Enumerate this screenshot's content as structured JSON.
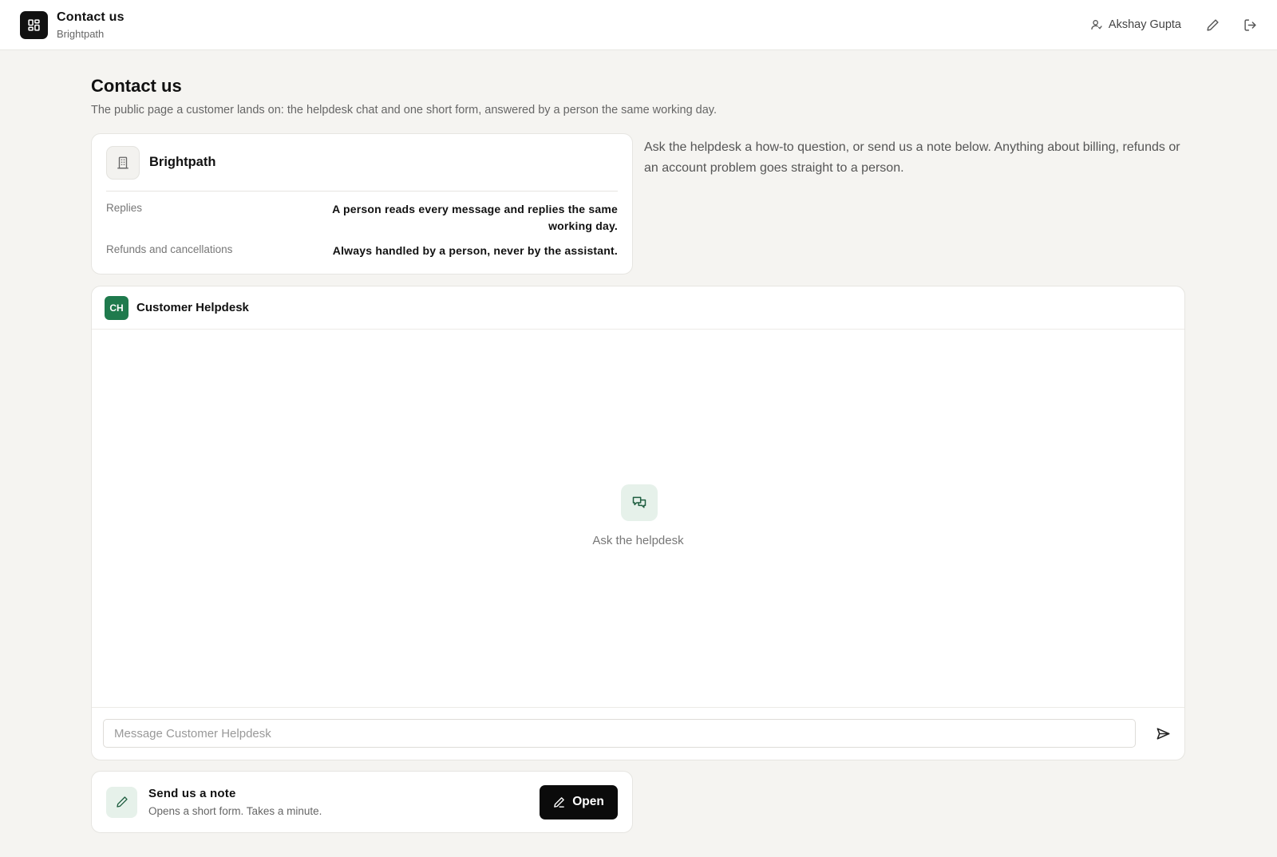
{
  "header": {
    "title": "Contact us",
    "subtitle": "Brightpath",
    "user_name": "Akshay Gupta",
    "icons": [
      "grid-icon",
      "user-icon",
      "pencil-icon",
      "logout-icon"
    ]
  },
  "page": {
    "title": "Contact us",
    "description": "The public page a customer lands on: the helpdesk chat and one short form, answered by a person the same working day."
  },
  "brand_card": {
    "name": "Brightpath",
    "rows": [
      {
        "label": "Replies",
        "value": "A person reads every message and replies the same working day."
      },
      {
        "label": "Refunds and cancellations",
        "value": "Always handled by a person, never by the assistant."
      }
    ]
  },
  "side_text": "Ask the helpdesk a how-to question, or send us a note below. Anything about billing, refunds or an account problem goes straight to a person.",
  "helpdesk": {
    "avatar_initials": "CH",
    "title": "Customer Helpdesk",
    "empty_label": "Ask the helpdesk",
    "input_placeholder": "Message Customer Helpdesk",
    "input_value": ""
  },
  "note": {
    "title": "Send us a note",
    "subtitle": "Opens a short form. Takes a minute.",
    "button_label": "Open"
  },
  "colors": {
    "accent_green": "#1f7a4d",
    "soft_green": "#e6f1ea",
    "page_bg": "#f5f4f1",
    "button_dark": "#0b0b0b"
  }
}
